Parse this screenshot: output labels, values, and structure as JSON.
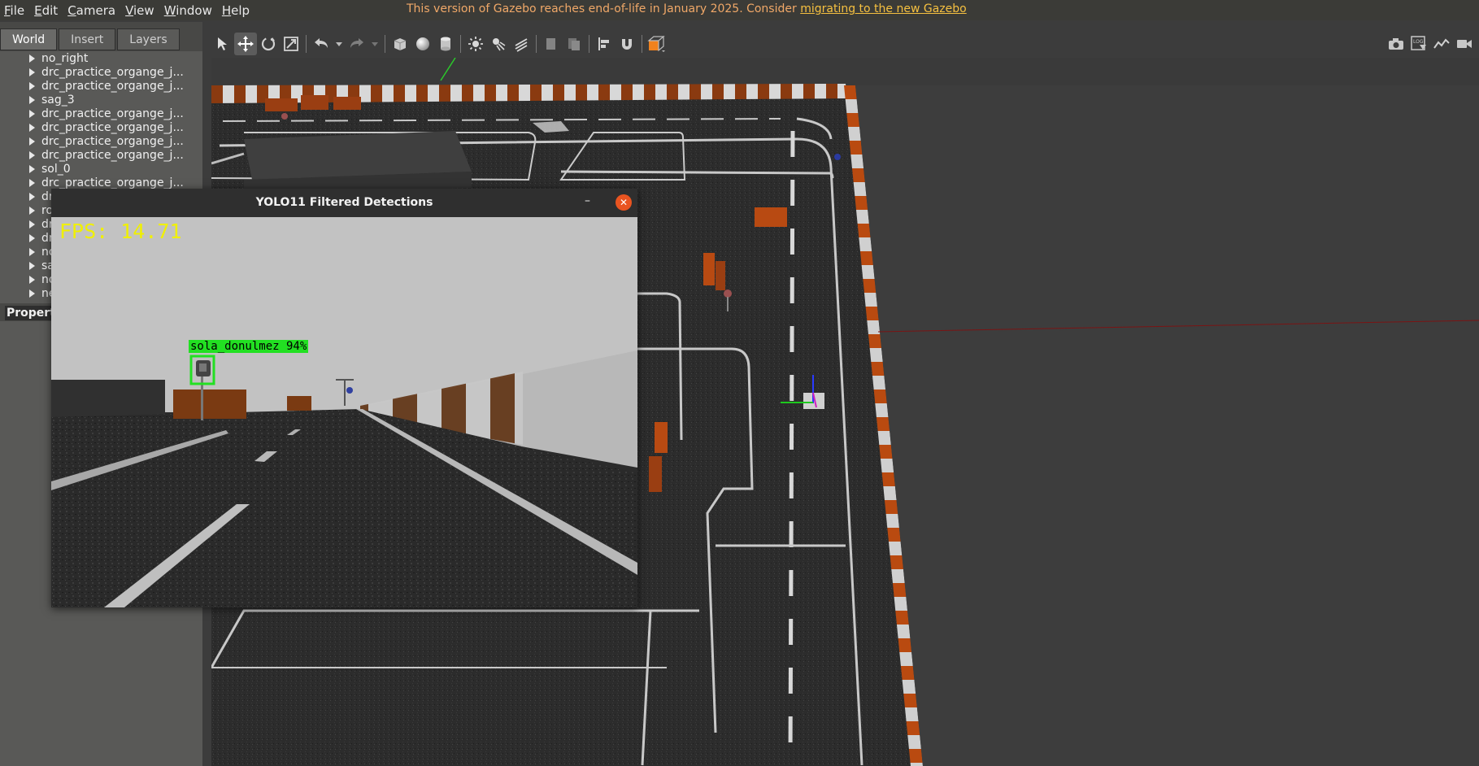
{
  "menubar": {
    "items": [
      "File",
      "Edit",
      "Camera",
      "View",
      "Window",
      "Help"
    ],
    "eol_text": "This version of Gazebo reaches end-of-life in January 2025. Consider ",
    "eol_link": "migrating to the new Gazebo"
  },
  "left_panel": {
    "tabs": [
      "World",
      "Insert",
      "Layers"
    ],
    "active_tab": "World",
    "tree_items": [
      "no_right",
      "drc_practice_organge_j...",
      "drc_practice_organge_j...",
      "sag_3",
      "drc_practice_organge_j...",
      "drc_practice_organge_j...",
      "drc_practice_organge_j...",
      "drc_practice_organge_j...",
      "sol_0",
      "drc_practice_organge_j...",
      "dr",
      "ro",
      "dr",
      "dr",
      "no",
      "sa",
      "no",
      "ne"
    ],
    "properties_header": "Property"
  },
  "toolbar": {
    "icons": [
      "select-arrow-icon",
      "translate-icon",
      "rotate-icon",
      "scale-icon",
      "undo-icon",
      "redo-icon",
      "box-icon",
      "sphere-icon",
      "cylinder-icon",
      "point-light-icon",
      "spot-light-icon",
      "directional-light-icon",
      "copy-icon",
      "paste-icon",
      "align-icon",
      "snap-icon",
      "view-angle-icon"
    ],
    "right_icons": [
      "camera-screenshot-icon",
      "log-icon",
      "plot-icon",
      "video-icon"
    ]
  },
  "detection_window": {
    "title": "YOLO11 Filtered Detections",
    "fps_label": "FPS: 14.71",
    "detection_label": "sola_donulmez 94%",
    "colors": {
      "fps": "#f0f000",
      "box": "#22e022",
      "close": "#e95420"
    }
  }
}
